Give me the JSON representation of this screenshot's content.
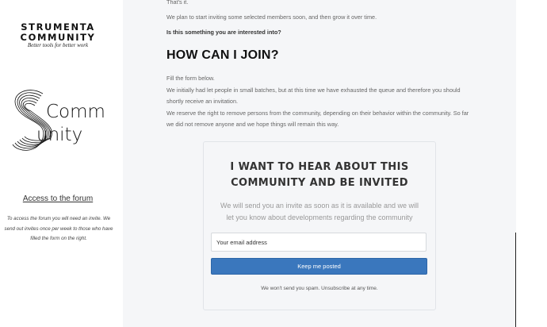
{
  "sidebar": {
    "brand_line1": "STRUMENTA",
    "brand_line2": "COMMUNITY",
    "tagline": "Better tools for better work",
    "logo": {
      "icon": "stylized-s-icon",
      "text_top": "Comm",
      "text_bottom": "unity"
    },
    "forum_title": "Access to the forum",
    "forum_note": "To access the forum you will need an invite. We send out invites once per week to those who have filled the form on the right."
  },
  "main": {
    "p_thats_it": "That's it.",
    "p_plan": "We plan to start inviting some selected members soon, and then grow it over time.",
    "p_question": "Is this something you are interested into?",
    "join_heading": "HOW CAN I JOIN?",
    "join_body": [
      "Fill the form below.",
      "We initially had let people in small batches, but at this time we have exhausted the queue and therefore you should shortly receive an invitation.",
      "We reserve the right to remove persons from the community, depending on their behavior within the community. So far we did not remove anyone and we hope things will remain this way."
    ],
    "form": {
      "heading": "I WANT TO HEAR ABOUT THIS COMMUNITY AND BE INVITED",
      "subheading": "We will send you an invite as soon as it is available and we will let you know about developments regarding the community",
      "email_placeholder": "Your email address",
      "email_value": "",
      "submit_label": "Keep me posted",
      "spam_note": "We won't send you spam. Unsubscribe at any time."
    }
  },
  "colors": {
    "accent": "#3a77bd",
    "main_background": "#f5f6f8",
    "heading": "#111111"
  }
}
